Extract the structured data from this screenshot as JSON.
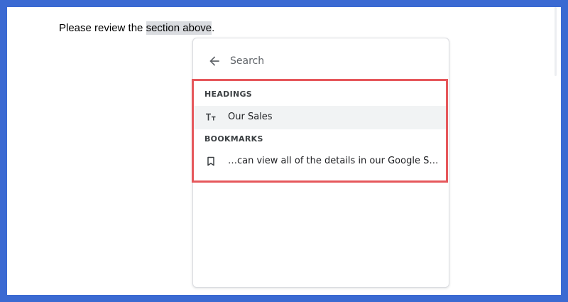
{
  "document": {
    "text_before": "Please review the ",
    "linked_text": "section above",
    "text_after": "."
  },
  "search": {
    "placeholder": "Search",
    "back_icon": "arrow-left-icon"
  },
  "results": {
    "headings_label": "HEADINGS",
    "headings": [
      {
        "label": "Our Sales",
        "icon": "text-size-icon"
      }
    ],
    "bookmarks_label": "BOOKMARKS",
    "bookmarks": [
      {
        "label": "…can view all of the details in our Google Sheets w…",
        "icon": "bookmark-icon"
      }
    ]
  },
  "colors": {
    "frame_border": "#3b6ad2",
    "annotation_outline": "#e6575b",
    "selected_row": "#f1f3f4",
    "text_highlight": "#dadce0"
  }
}
